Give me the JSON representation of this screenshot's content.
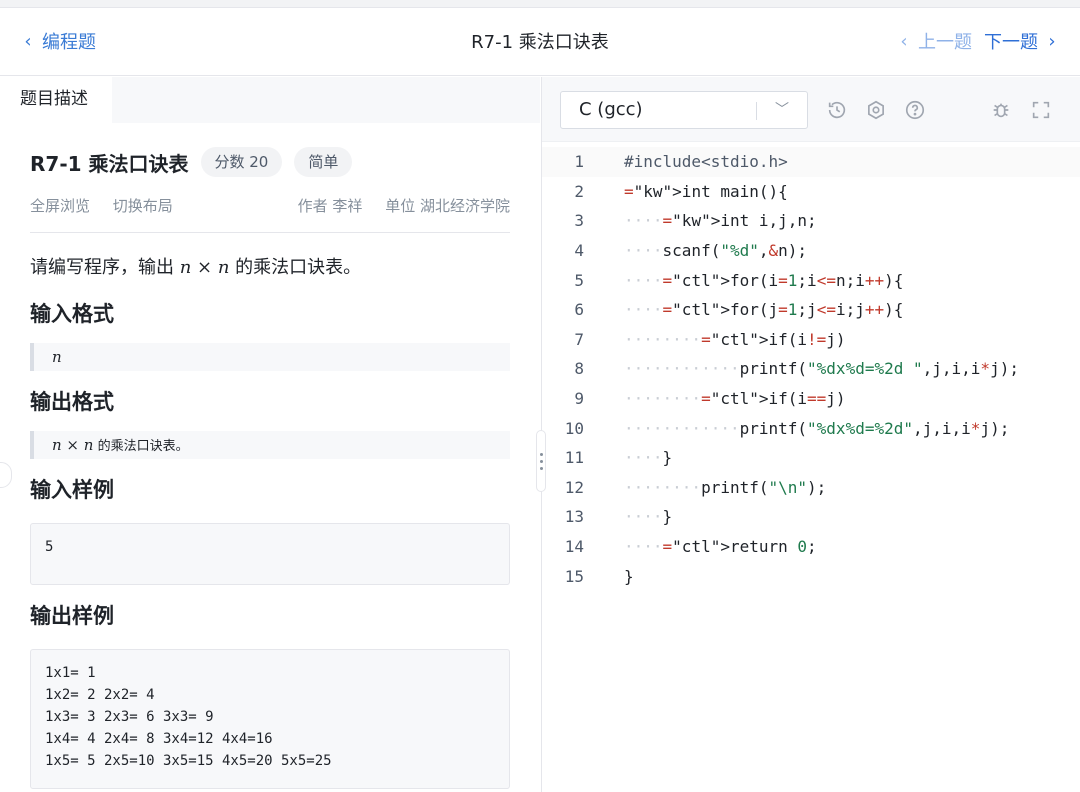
{
  "header": {
    "back_label": "编程题",
    "title": "R7-1 乘法口诀表",
    "prev_label": "上一题",
    "next_label": "下一题"
  },
  "left_panel": {
    "tab_label": "题目描述",
    "problem_title": "R7-1 乘法口诀表",
    "score_tag": "分数 20",
    "difficulty_tag": "简单",
    "fullscreen_label": "全屏浏览",
    "switch_layout_label": "切换布局",
    "author": "作者 李祥",
    "unit": "单位 湖北经济学院",
    "description_pre": "请编写程序，输出 ",
    "description_math": "n × n",
    "description_post": " 的乘法口诀表。",
    "input_format_heading": "输入格式",
    "input_format_math": "n",
    "output_format_heading": "输出格式",
    "output_format_math": "n × n",
    "output_format_text": " 的乘法口诀表。",
    "input_sample_heading": "输入样例",
    "input_sample": "5",
    "output_sample_heading": "输出样例",
    "output_sample": "1x1= 1\n1x2= 2 2x2= 4\n1x3= 3 2x3= 6 3x3= 9\n1x4= 4 2x4= 8 3x4=12 4x4=16\n1x5= 5 2x5=10 3x5=15 4x5=20 5x5=25"
  },
  "editor": {
    "language": "C (gcc)",
    "icons": [
      "history-icon",
      "settings-icon",
      "help-icon",
      "debug-icon",
      "fullscreen-icon"
    ],
    "line_numbers": [
      "1",
      "2",
      "3",
      "4",
      "5",
      "6",
      "7",
      "8",
      "9",
      "10",
      "11",
      "12",
      "13",
      "14",
      "15"
    ],
    "lines": [
      "#include<stdio.h>",
      "int main(){",
      "    int i,j,n;",
      "    scanf(\"%d\",&n);",
      "    for(i=1;i<=n;i++){",
      "    for(j=1;j<=i;j++){",
      "        if(i!=j)",
      "            printf(\"%dx%d=%2d \",j,i,i*j);",
      "        if(i==j)",
      "            printf(\"%dx%d=%2d\",j,i,i*j);",
      "    }",
      "        printf(\"\\n\");",
      "    }",
      "    return 0;",
      "}"
    ]
  },
  "colors": {
    "accent": "#2f6fd6",
    "keyword": "#2f6fd6",
    "control": "#c0392b",
    "string": "#1f7a4d",
    "panel_bg": "#f7f8fa"
  }
}
